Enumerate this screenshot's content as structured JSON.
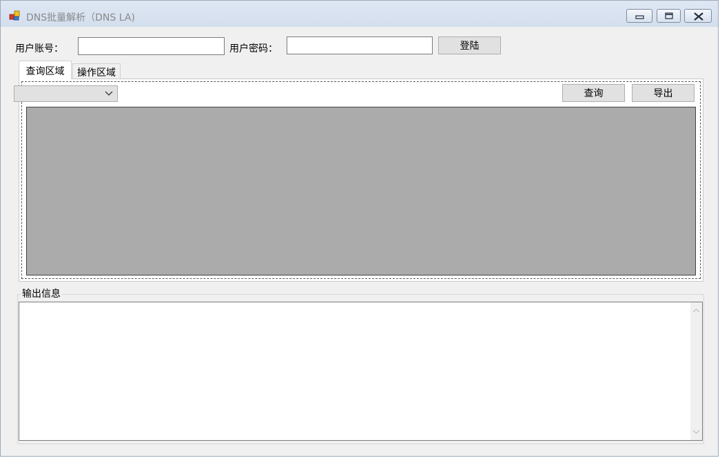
{
  "window": {
    "title": "DNS批量解析（DNS LA)"
  },
  "login": {
    "account_label": "用户账号：",
    "account_value": "",
    "password_label": "用户密码：",
    "password_value": "",
    "login_button": "登陆"
  },
  "tabs": [
    {
      "label": "查询区域",
      "active": true
    },
    {
      "label": "操作区域",
      "active": false
    }
  ],
  "query": {
    "dropdown_selected": "",
    "query_button": "查询",
    "export_button": "导出"
  },
  "output": {
    "group_title": "输出信息",
    "text": ""
  },
  "icons": {
    "app": "app-icon",
    "minimize": "minimize-icon",
    "restore": "restore-icon",
    "close": "close-icon",
    "dropdown": "chevron-down-icon",
    "scroll_up": "scroll-up-icon",
    "scroll_down": "scroll-down-icon"
  },
  "colors": {
    "titlebar": "#d3deee",
    "window_bg": "#f0f0f0",
    "grid_bg": "#ababab",
    "button_bg": "#e1e1e1"
  }
}
